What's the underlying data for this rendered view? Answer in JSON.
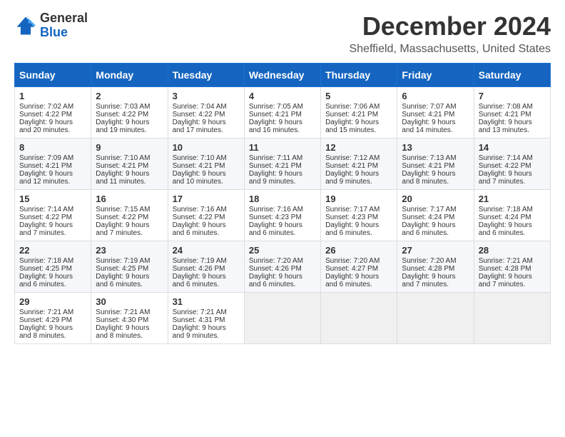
{
  "logo": {
    "line1": "General",
    "line2": "Blue"
  },
  "title": "December 2024",
  "location": "Sheffield, Massachusetts, United States",
  "days_of_week": [
    "Sunday",
    "Monday",
    "Tuesday",
    "Wednesday",
    "Thursday",
    "Friday",
    "Saturday"
  ],
  "weeks": [
    [
      {
        "day": "1",
        "sunrise": "Sunrise: 7:02 AM",
        "sunset": "Sunset: 4:22 PM",
        "daylight": "Daylight: 9 hours and 20 minutes."
      },
      {
        "day": "2",
        "sunrise": "Sunrise: 7:03 AM",
        "sunset": "Sunset: 4:22 PM",
        "daylight": "Daylight: 9 hours and 19 minutes."
      },
      {
        "day": "3",
        "sunrise": "Sunrise: 7:04 AM",
        "sunset": "Sunset: 4:22 PM",
        "daylight": "Daylight: 9 hours and 17 minutes."
      },
      {
        "day": "4",
        "sunrise": "Sunrise: 7:05 AM",
        "sunset": "Sunset: 4:21 PM",
        "daylight": "Daylight: 9 hours and 16 minutes."
      },
      {
        "day": "5",
        "sunrise": "Sunrise: 7:06 AM",
        "sunset": "Sunset: 4:21 PM",
        "daylight": "Daylight: 9 hours and 15 minutes."
      },
      {
        "day": "6",
        "sunrise": "Sunrise: 7:07 AM",
        "sunset": "Sunset: 4:21 PM",
        "daylight": "Daylight: 9 hours and 14 minutes."
      },
      {
        "day": "7",
        "sunrise": "Sunrise: 7:08 AM",
        "sunset": "Sunset: 4:21 PM",
        "daylight": "Daylight: 9 hours and 13 minutes."
      }
    ],
    [
      {
        "day": "8",
        "sunrise": "Sunrise: 7:09 AM",
        "sunset": "Sunset: 4:21 PM",
        "daylight": "Daylight: 9 hours and 12 minutes."
      },
      {
        "day": "9",
        "sunrise": "Sunrise: 7:10 AM",
        "sunset": "Sunset: 4:21 PM",
        "daylight": "Daylight: 9 hours and 11 minutes."
      },
      {
        "day": "10",
        "sunrise": "Sunrise: 7:10 AM",
        "sunset": "Sunset: 4:21 PM",
        "daylight": "Daylight: 9 hours and 10 minutes."
      },
      {
        "day": "11",
        "sunrise": "Sunrise: 7:11 AM",
        "sunset": "Sunset: 4:21 PM",
        "daylight": "Daylight: 9 hours and 9 minutes."
      },
      {
        "day": "12",
        "sunrise": "Sunrise: 7:12 AM",
        "sunset": "Sunset: 4:21 PM",
        "daylight": "Daylight: 9 hours and 9 minutes."
      },
      {
        "day": "13",
        "sunrise": "Sunrise: 7:13 AM",
        "sunset": "Sunset: 4:21 PM",
        "daylight": "Daylight: 9 hours and 8 minutes."
      },
      {
        "day": "14",
        "sunrise": "Sunrise: 7:14 AM",
        "sunset": "Sunset: 4:22 PM",
        "daylight": "Daylight: 9 hours and 7 minutes."
      }
    ],
    [
      {
        "day": "15",
        "sunrise": "Sunrise: 7:14 AM",
        "sunset": "Sunset: 4:22 PM",
        "daylight": "Daylight: 9 hours and 7 minutes."
      },
      {
        "day": "16",
        "sunrise": "Sunrise: 7:15 AM",
        "sunset": "Sunset: 4:22 PM",
        "daylight": "Daylight: 9 hours and 7 minutes."
      },
      {
        "day": "17",
        "sunrise": "Sunrise: 7:16 AM",
        "sunset": "Sunset: 4:22 PM",
        "daylight": "Daylight: 9 hours and 6 minutes."
      },
      {
        "day": "18",
        "sunrise": "Sunrise: 7:16 AM",
        "sunset": "Sunset: 4:23 PM",
        "daylight": "Daylight: 9 hours and 6 minutes."
      },
      {
        "day": "19",
        "sunrise": "Sunrise: 7:17 AM",
        "sunset": "Sunset: 4:23 PM",
        "daylight": "Daylight: 9 hours and 6 minutes."
      },
      {
        "day": "20",
        "sunrise": "Sunrise: 7:17 AM",
        "sunset": "Sunset: 4:24 PM",
        "daylight": "Daylight: 9 hours and 6 minutes."
      },
      {
        "day": "21",
        "sunrise": "Sunrise: 7:18 AM",
        "sunset": "Sunset: 4:24 PM",
        "daylight": "Daylight: 9 hours and 6 minutes."
      }
    ],
    [
      {
        "day": "22",
        "sunrise": "Sunrise: 7:18 AM",
        "sunset": "Sunset: 4:25 PM",
        "daylight": "Daylight: 9 hours and 6 minutes."
      },
      {
        "day": "23",
        "sunrise": "Sunrise: 7:19 AM",
        "sunset": "Sunset: 4:25 PM",
        "daylight": "Daylight: 9 hours and 6 minutes."
      },
      {
        "day": "24",
        "sunrise": "Sunrise: 7:19 AM",
        "sunset": "Sunset: 4:26 PM",
        "daylight": "Daylight: 9 hours and 6 minutes."
      },
      {
        "day": "25",
        "sunrise": "Sunrise: 7:20 AM",
        "sunset": "Sunset: 4:26 PM",
        "daylight": "Daylight: 9 hours and 6 minutes."
      },
      {
        "day": "26",
        "sunrise": "Sunrise: 7:20 AM",
        "sunset": "Sunset: 4:27 PM",
        "daylight": "Daylight: 9 hours and 6 minutes."
      },
      {
        "day": "27",
        "sunrise": "Sunrise: 7:20 AM",
        "sunset": "Sunset: 4:28 PM",
        "daylight": "Daylight: 9 hours and 7 minutes."
      },
      {
        "day": "28",
        "sunrise": "Sunrise: 7:21 AM",
        "sunset": "Sunset: 4:28 PM",
        "daylight": "Daylight: 9 hours and 7 minutes."
      }
    ],
    [
      {
        "day": "29",
        "sunrise": "Sunrise: 7:21 AM",
        "sunset": "Sunset: 4:29 PM",
        "daylight": "Daylight: 9 hours and 8 minutes."
      },
      {
        "day": "30",
        "sunrise": "Sunrise: 7:21 AM",
        "sunset": "Sunset: 4:30 PM",
        "daylight": "Daylight: 9 hours and 8 minutes."
      },
      {
        "day": "31",
        "sunrise": "Sunrise: 7:21 AM",
        "sunset": "Sunset: 4:31 PM",
        "daylight": "Daylight: 9 hours and 9 minutes."
      },
      null,
      null,
      null,
      null
    ]
  ]
}
